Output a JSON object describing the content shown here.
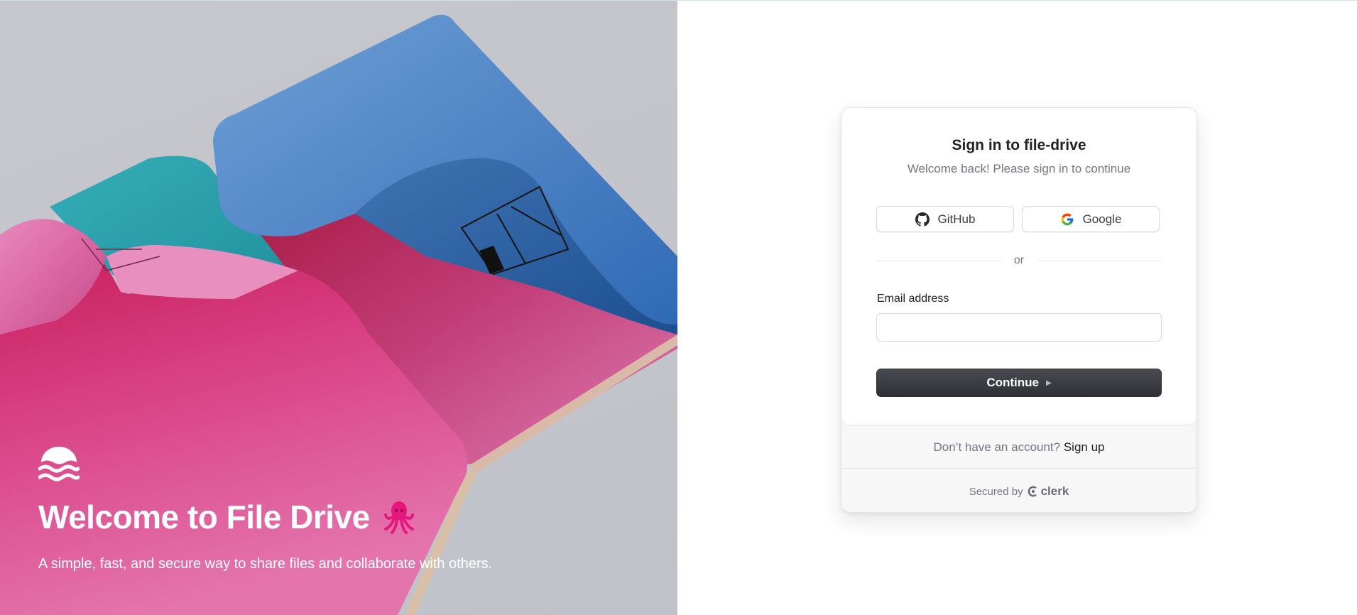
{
  "hero": {
    "title": "Welcome to File Drive",
    "subtitle": "A simple, fast, and secure way to share files and collaborate with others.",
    "logo_icon": "waves-logo-icon",
    "mascot_icon": "octopus-icon",
    "accent_color": "#e5167c"
  },
  "signin": {
    "title": "Sign in to file-drive",
    "subtitle": "Welcome back! Please sign in to continue",
    "github_label": "GitHub",
    "google_label": "Google",
    "divider_text": "or",
    "email_label": "Email address",
    "email_value": "",
    "email_placeholder": "",
    "continue_label": "Continue",
    "no_account_text": "Don’t have an account?",
    "signup_link": "Sign up",
    "secured_by": "Secured by",
    "secured_brand": "clerk",
    "button_color": "#2f3036"
  }
}
